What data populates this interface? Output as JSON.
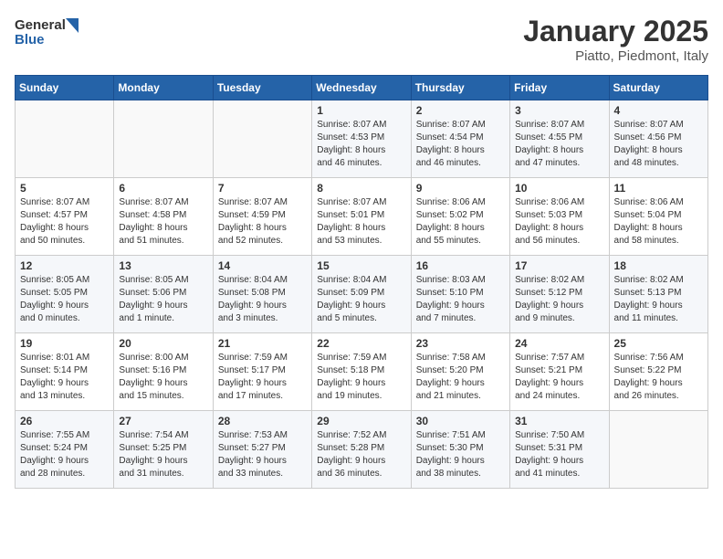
{
  "header": {
    "logo": {
      "general": "General",
      "blue": "Blue"
    },
    "title": "January 2025",
    "location": "Piatto, Piedmont, Italy"
  },
  "weekdays": [
    "Sunday",
    "Monday",
    "Tuesday",
    "Wednesday",
    "Thursday",
    "Friday",
    "Saturday"
  ],
  "weeks": [
    [
      {
        "day": "",
        "info": ""
      },
      {
        "day": "",
        "info": ""
      },
      {
        "day": "",
        "info": ""
      },
      {
        "day": "1",
        "info": "Sunrise: 8:07 AM\nSunset: 4:53 PM\nDaylight: 8 hours\nand 46 minutes."
      },
      {
        "day": "2",
        "info": "Sunrise: 8:07 AM\nSunset: 4:54 PM\nDaylight: 8 hours\nand 46 minutes."
      },
      {
        "day": "3",
        "info": "Sunrise: 8:07 AM\nSunset: 4:55 PM\nDaylight: 8 hours\nand 47 minutes."
      },
      {
        "day": "4",
        "info": "Sunrise: 8:07 AM\nSunset: 4:56 PM\nDaylight: 8 hours\nand 48 minutes."
      }
    ],
    [
      {
        "day": "5",
        "info": "Sunrise: 8:07 AM\nSunset: 4:57 PM\nDaylight: 8 hours\nand 50 minutes."
      },
      {
        "day": "6",
        "info": "Sunrise: 8:07 AM\nSunset: 4:58 PM\nDaylight: 8 hours\nand 51 minutes."
      },
      {
        "day": "7",
        "info": "Sunrise: 8:07 AM\nSunset: 4:59 PM\nDaylight: 8 hours\nand 52 minutes."
      },
      {
        "day": "8",
        "info": "Sunrise: 8:07 AM\nSunset: 5:01 PM\nDaylight: 8 hours\nand 53 minutes."
      },
      {
        "day": "9",
        "info": "Sunrise: 8:06 AM\nSunset: 5:02 PM\nDaylight: 8 hours\nand 55 minutes."
      },
      {
        "day": "10",
        "info": "Sunrise: 8:06 AM\nSunset: 5:03 PM\nDaylight: 8 hours\nand 56 minutes."
      },
      {
        "day": "11",
        "info": "Sunrise: 8:06 AM\nSunset: 5:04 PM\nDaylight: 8 hours\nand 58 minutes."
      }
    ],
    [
      {
        "day": "12",
        "info": "Sunrise: 8:05 AM\nSunset: 5:05 PM\nDaylight: 9 hours\nand 0 minutes."
      },
      {
        "day": "13",
        "info": "Sunrise: 8:05 AM\nSunset: 5:06 PM\nDaylight: 9 hours\nand 1 minute."
      },
      {
        "day": "14",
        "info": "Sunrise: 8:04 AM\nSunset: 5:08 PM\nDaylight: 9 hours\nand 3 minutes."
      },
      {
        "day": "15",
        "info": "Sunrise: 8:04 AM\nSunset: 5:09 PM\nDaylight: 9 hours\nand 5 minutes."
      },
      {
        "day": "16",
        "info": "Sunrise: 8:03 AM\nSunset: 5:10 PM\nDaylight: 9 hours\nand 7 minutes."
      },
      {
        "day": "17",
        "info": "Sunrise: 8:02 AM\nSunset: 5:12 PM\nDaylight: 9 hours\nand 9 minutes."
      },
      {
        "day": "18",
        "info": "Sunrise: 8:02 AM\nSunset: 5:13 PM\nDaylight: 9 hours\nand 11 minutes."
      }
    ],
    [
      {
        "day": "19",
        "info": "Sunrise: 8:01 AM\nSunset: 5:14 PM\nDaylight: 9 hours\nand 13 minutes."
      },
      {
        "day": "20",
        "info": "Sunrise: 8:00 AM\nSunset: 5:16 PM\nDaylight: 9 hours\nand 15 minutes."
      },
      {
        "day": "21",
        "info": "Sunrise: 7:59 AM\nSunset: 5:17 PM\nDaylight: 9 hours\nand 17 minutes."
      },
      {
        "day": "22",
        "info": "Sunrise: 7:59 AM\nSunset: 5:18 PM\nDaylight: 9 hours\nand 19 minutes."
      },
      {
        "day": "23",
        "info": "Sunrise: 7:58 AM\nSunset: 5:20 PM\nDaylight: 9 hours\nand 21 minutes."
      },
      {
        "day": "24",
        "info": "Sunrise: 7:57 AM\nSunset: 5:21 PM\nDaylight: 9 hours\nand 24 minutes."
      },
      {
        "day": "25",
        "info": "Sunrise: 7:56 AM\nSunset: 5:22 PM\nDaylight: 9 hours\nand 26 minutes."
      }
    ],
    [
      {
        "day": "26",
        "info": "Sunrise: 7:55 AM\nSunset: 5:24 PM\nDaylight: 9 hours\nand 28 minutes."
      },
      {
        "day": "27",
        "info": "Sunrise: 7:54 AM\nSunset: 5:25 PM\nDaylight: 9 hours\nand 31 minutes."
      },
      {
        "day": "28",
        "info": "Sunrise: 7:53 AM\nSunset: 5:27 PM\nDaylight: 9 hours\nand 33 minutes."
      },
      {
        "day": "29",
        "info": "Sunrise: 7:52 AM\nSunset: 5:28 PM\nDaylight: 9 hours\nand 36 minutes."
      },
      {
        "day": "30",
        "info": "Sunrise: 7:51 AM\nSunset: 5:30 PM\nDaylight: 9 hours\nand 38 minutes."
      },
      {
        "day": "31",
        "info": "Sunrise: 7:50 AM\nSunset: 5:31 PM\nDaylight: 9 hours\nand 41 minutes."
      },
      {
        "day": "",
        "info": ""
      }
    ]
  ]
}
